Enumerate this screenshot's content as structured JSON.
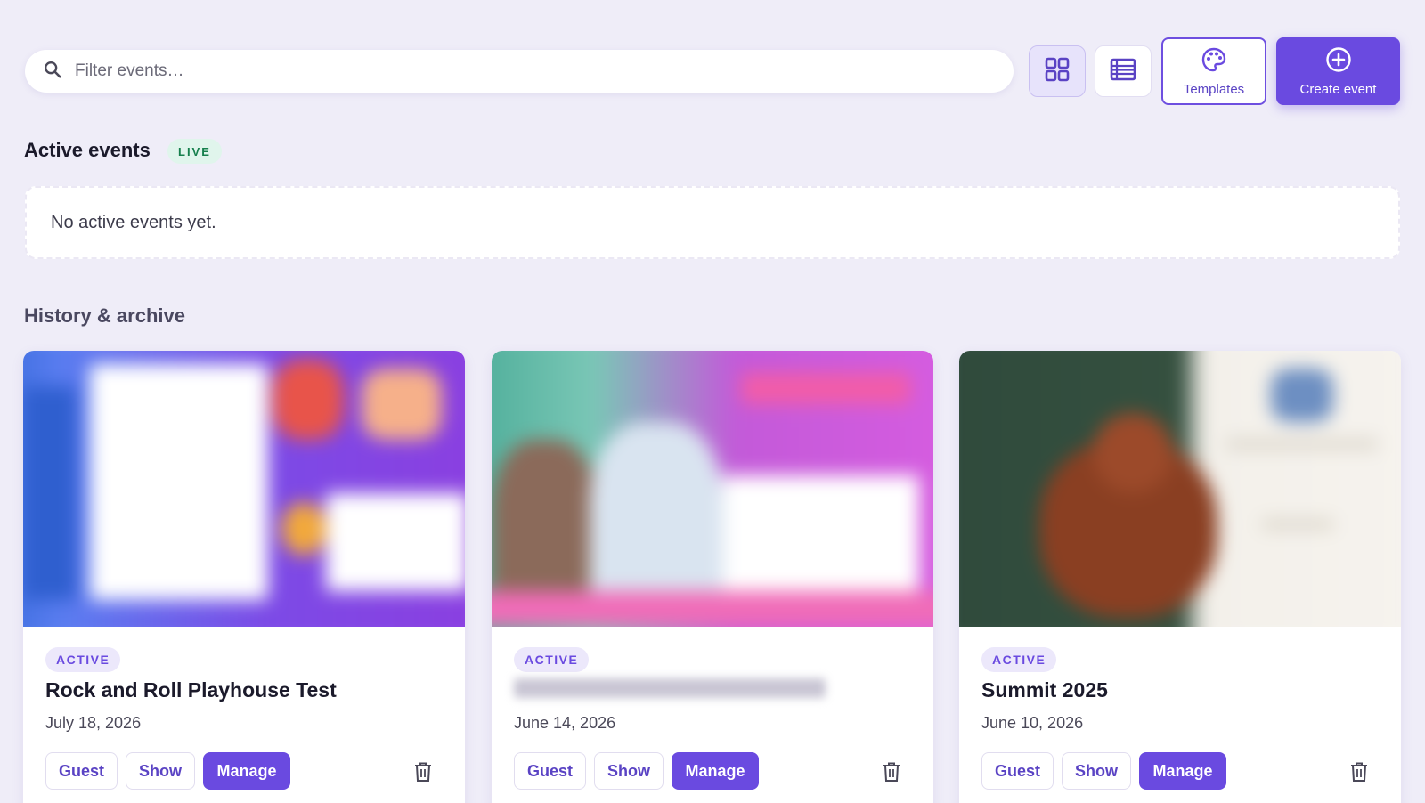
{
  "toolbar": {
    "search_placeholder": "Filter events…",
    "search_icon": "search-icon",
    "grid_view_icon": "grid-icon",
    "list_view_icon": "list-icon",
    "templates_label": "Templates",
    "templates_icon": "palette-icon",
    "create_label": "Create event",
    "create_icon": "plus-circle-icon"
  },
  "active_section": {
    "title": "Active events",
    "badge": "LIVE",
    "empty_text": "No active events yet."
  },
  "history_section": {
    "title": "History & archive",
    "cards": [
      {
        "status": "ACTIVE",
        "title": "Rock and Roll Playhouse Test",
        "date": "July 18, 2026",
        "guest_label": "Guest",
        "show_label": "Show",
        "manage_label": "Manage"
      },
      {
        "status": "ACTIVE",
        "title": "",
        "date": "June 14, 2026",
        "guest_label": "Guest",
        "show_label": "Show",
        "manage_label": "Manage"
      },
      {
        "status": "ACTIVE",
        "title": "Summit 2025",
        "date": "June 10, 2026",
        "guest_label": "Guest",
        "show_label": "Show",
        "manage_label": "Manage"
      }
    ]
  },
  "colors": {
    "accent": "#6a4ae0",
    "background": "#efedf8",
    "live_badge_bg": "#e0f5ec",
    "live_badge_text": "#16804d"
  }
}
